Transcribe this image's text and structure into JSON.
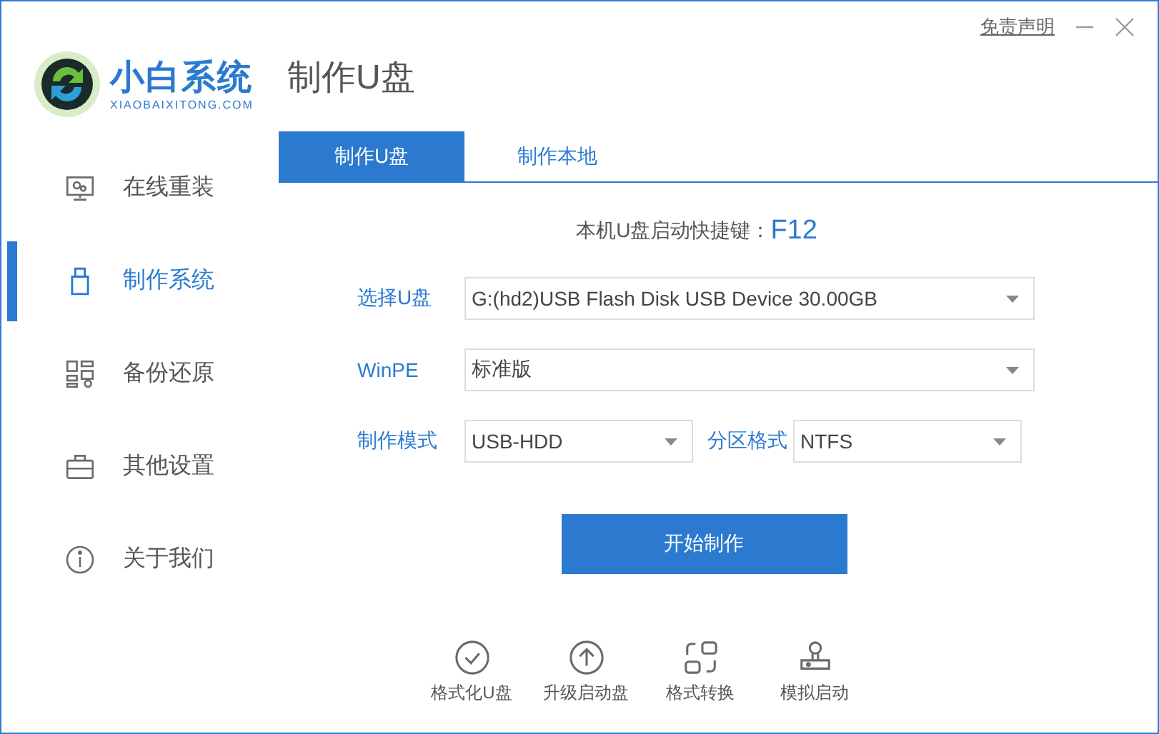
{
  "header": {
    "logo_text": "小白系统",
    "logo_subtext": "XIAOBAIXITONG.COM",
    "page_title": "制作U盘",
    "disclaimer_link": "免责声明"
  },
  "sidebar": {
    "items": [
      {
        "label": "在线重装",
        "kind": "monitor",
        "selected": false
      },
      {
        "label": "制作系统",
        "kind": "usb",
        "selected": true
      },
      {
        "label": "备份还原",
        "kind": "grid",
        "selected": false
      },
      {
        "label": "其他设置",
        "kind": "briefcase",
        "selected": false
      },
      {
        "label": "关于我们",
        "kind": "info",
        "selected": false
      }
    ]
  },
  "tabs": [
    {
      "label": "制作U盘",
      "selected": true
    },
    {
      "label": "制作本地",
      "selected": false
    }
  ],
  "hotkey": {
    "label": "本机U盘启动快捷键：",
    "key": "F12"
  },
  "form": {
    "rows": [
      [
        {
          "label": "选择U盘",
          "value": "G:(hd2)USB Flash Disk USB Device 30.00GB"
        }
      ],
      [
        {
          "label": "WinPE",
          "value": "标准版"
        }
      ],
      [
        {
          "label": "制作模式",
          "value": "USB-HDD"
        },
        {
          "label": "分区格式",
          "value": "NTFS"
        }
      ]
    ]
  },
  "start_button": "开始制作",
  "tools": [
    {
      "label": "格式化U盘",
      "kind": "check"
    },
    {
      "label": "升级启动盘",
      "kind": "upload"
    },
    {
      "label": "格式转换",
      "kind": "convert"
    },
    {
      "label": "模拟启动",
      "kind": "simulate"
    }
  ]
}
